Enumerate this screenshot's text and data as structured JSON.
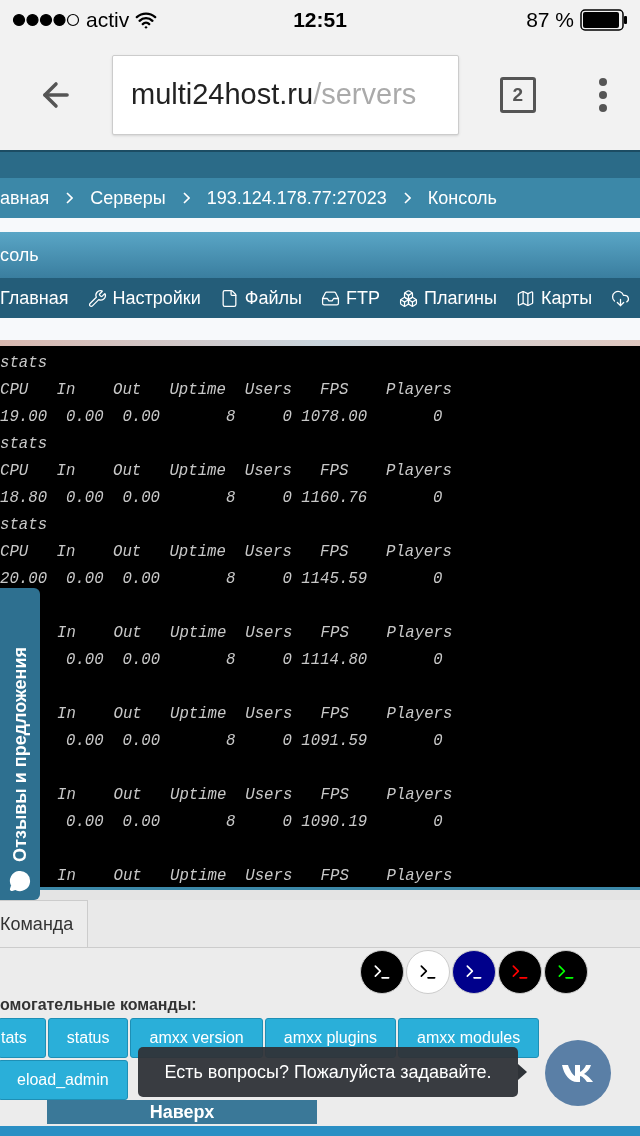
{
  "status_bar": {
    "carrier": "activ",
    "time": "12:51",
    "battery": "87 %"
  },
  "browser": {
    "url_host": "multi24host.ru",
    "url_path": "/servers",
    "tab_count": "2"
  },
  "breadcrumbs": [
    "авная",
    "Серверы",
    "193.124.178.77:27023",
    "Консоль"
  ],
  "page_title": "соль",
  "nav_tabs": [
    "Главная",
    "Настройки",
    "Файлы",
    "FTP",
    "Плагины",
    "Карты"
  ],
  "console": {
    "blocks": [
      {
        "kind": "full",
        "lines": [
          "stats",
          "CPU   In    Out   Uptime  Users   FPS    Players",
          "19.00  0.00  0.00       8     0 1078.00       0"
        ]
      },
      {
        "kind": "full",
        "lines": [
          "stats",
          "CPU   In    Out   Uptime  Users   FPS    Players",
          "18.80  0.00  0.00       8     0 1160.76       0"
        ]
      },
      {
        "kind": "full",
        "lines": [
          "stats",
          "CPU   In    Out   Uptime  Users   FPS    Players",
          "20.00  0.00  0.00       8     0 1145.59       0"
        ]
      },
      {
        "kind": "covered",
        "lines": [
          "In    Out   Uptime  Users   FPS    Players",
          "0.00  0.00       8     0 1114.80       0"
        ]
      },
      {
        "kind": "covered",
        "lines": [
          "In    Out   Uptime  Users   FPS    Players",
          "0.00  0.00       8     0 1091.59       0"
        ]
      },
      {
        "kind": "covered",
        "lines": [
          "In    Out   Uptime  Users   FPS    Players",
          "0.00  0.00       8     0 1090.19       0"
        ]
      },
      {
        "kind": "covered",
        "lines": [
          "In    Out   Uptime  Users   FPS    Players"
        ]
      }
    ]
  },
  "feedback_tab": "Отзывы и предложения",
  "command_tab": "Команда",
  "themes": [
    {
      "color": "#000000",
      "kind": "light"
    },
    {
      "color": "#ffffff",
      "kind": "dark"
    },
    {
      "color": "#00008b",
      "kind": "light"
    },
    {
      "color": "#000000",
      "kind": "red"
    },
    {
      "color": "#000000",
      "kind": "green"
    }
  ],
  "helper_label": "омогательные команды:",
  "helper_commands": [
    "tats",
    "status",
    "amxx version",
    "amxx plugins",
    "amxx modules",
    "eload_admin"
  ],
  "tooltip": "Есть вопросы? Пожалуйста задавайте.",
  "top_button": "Наверх"
}
